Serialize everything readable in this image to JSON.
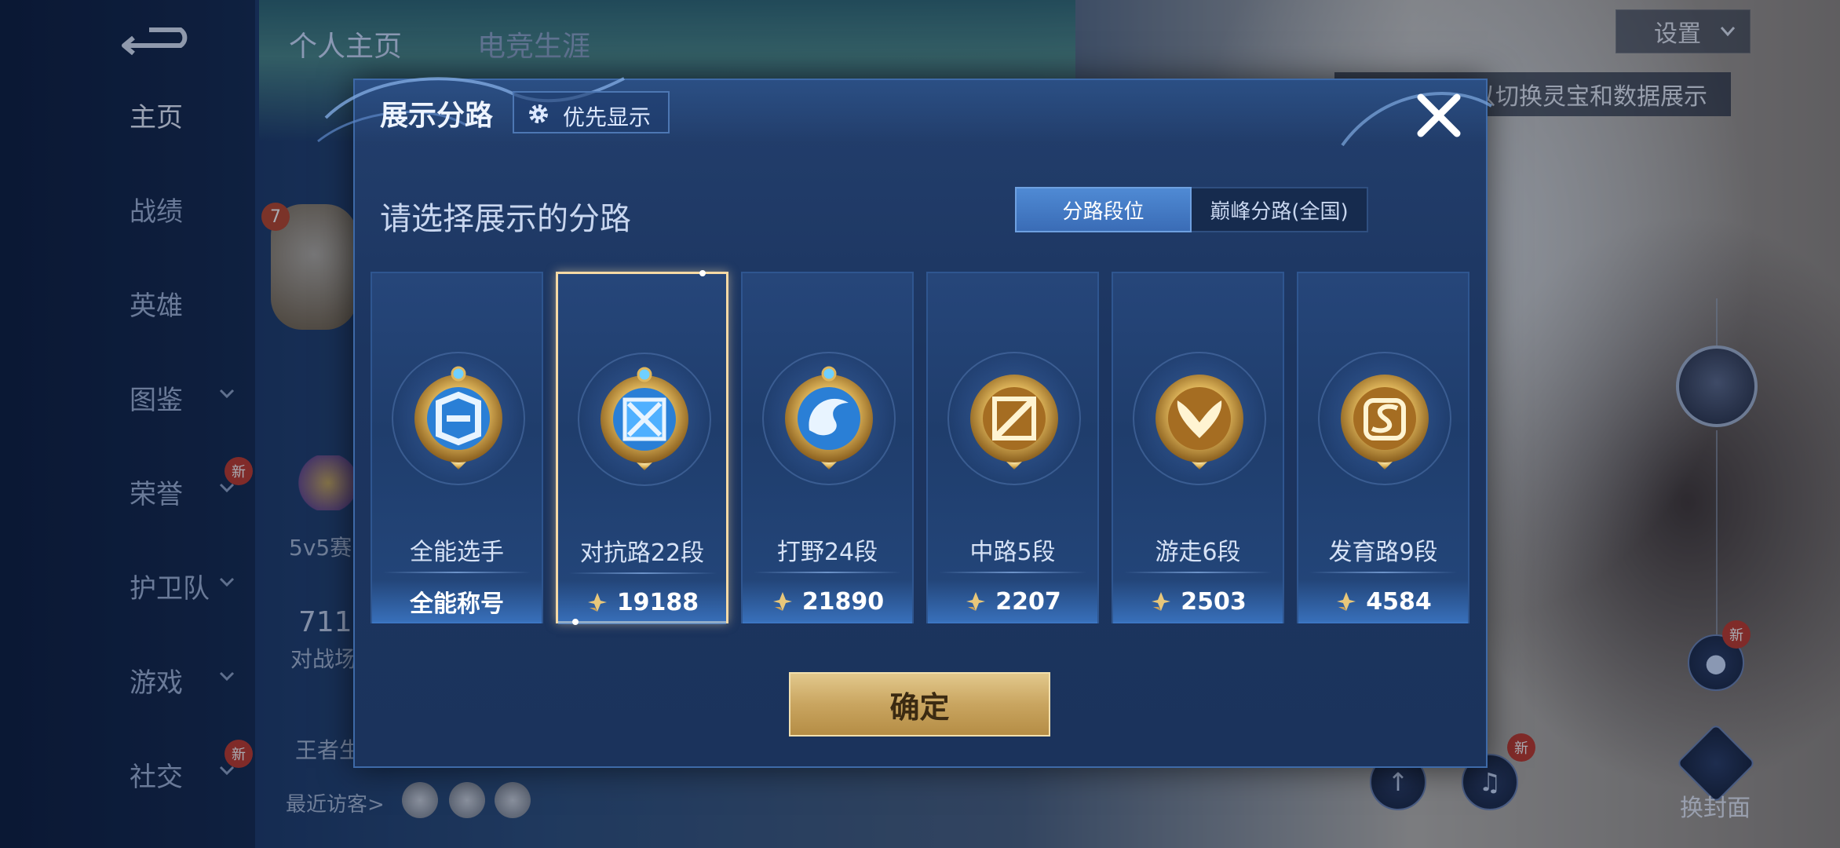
{
  "background": {
    "top_tabs": [
      "个人主页",
      "电竞生涯"
    ],
    "settings_label": "设置",
    "hint_text": "以切换灵宝和数据展示",
    "sidebar": [
      {
        "label": "主页",
        "active": true,
        "chevron": false,
        "badge": ""
      },
      {
        "label": "战绩",
        "active": false,
        "chevron": false,
        "badge": ""
      },
      {
        "label": "英雄",
        "active": false,
        "chevron": false,
        "badge": ""
      },
      {
        "label": "图鉴",
        "active": false,
        "chevron": true,
        "badge": ""
      },
      {
        "label": "荣誉",
        "active": false,
        "chevron": true,
        "badge": "新"
      },
      {
        "label": "护卫队",
        "active": false,
        "chevron": true,
        "badge": ""
      },
      {
        "label": "游戏",
        "active": false,
        "chevron": true,
        "badge": ""
      },
      {
        "label": "社交",
        "active": false,
        "chevron": true,
        "badge": "新"
      }
    ],
    "level_badge": "7",
    "peek_mode": "5v5赛",
    "peek_count": "711",
    "peek_count_label": "对战场",
    "peek_king": "王者生",
    "recent_visitors_label": "最近访客>",
    "right_badges": [
      "新",
      "新"
    ],
    "change_cover_label": "换封面"
  },
  "modal": {
    "title": "展示分路",
    "priority_label": "优先显示",
    "prompt": "请选择展示的分路",
    "segments": [
      {
        "label": "分路段位",
        "active": true
      },
      {
        "label": "巅峰分路(全国)",
        "active": false
      }
    ],
    "cards": [
      {
        "name": "全能选手",
        "value": "全能称号",
        "show_power": false,
        "selected": false,
        "emblem": "all-round-emblem-icon"
      },
      {
        "name": "对抗路22段",
        "value": "19188",
        "show_power": true,
        "selected": true,
        "emblem": "clash-lane-emblem-icon"
      },
      {
        "name": "打野24段",
        "value": "21890",
        "show_power": true,
        "selected": false,
        "emblem": "jungle-dragon-emblem-icon"
      },
      {
        "name": "中路5段",
        "value": "2207",
        "show_power": true,
        "selected": false,
        "emblem": "mid-lane-emblem-icon"
      },
      {
        "name": "游走6段",
        "value": "2503",
        "show_power": true,
        "selected": false,
        "emblem": "roam-wings-emblem-icon"
      },
      {
        "name": "发育路9段",
        "value": "4584",
        "show_power": true,
        "selected": false,
        "emblem": "farm-lane-emblem-icon"
      }
    ],
    "confirm_label": "确定"
  },
  "colors": {
    "accent_blue": "#4f8ad4",
    "gold": "#c9a560",
    "selected_border": "#f5d9a5"
  }
}
